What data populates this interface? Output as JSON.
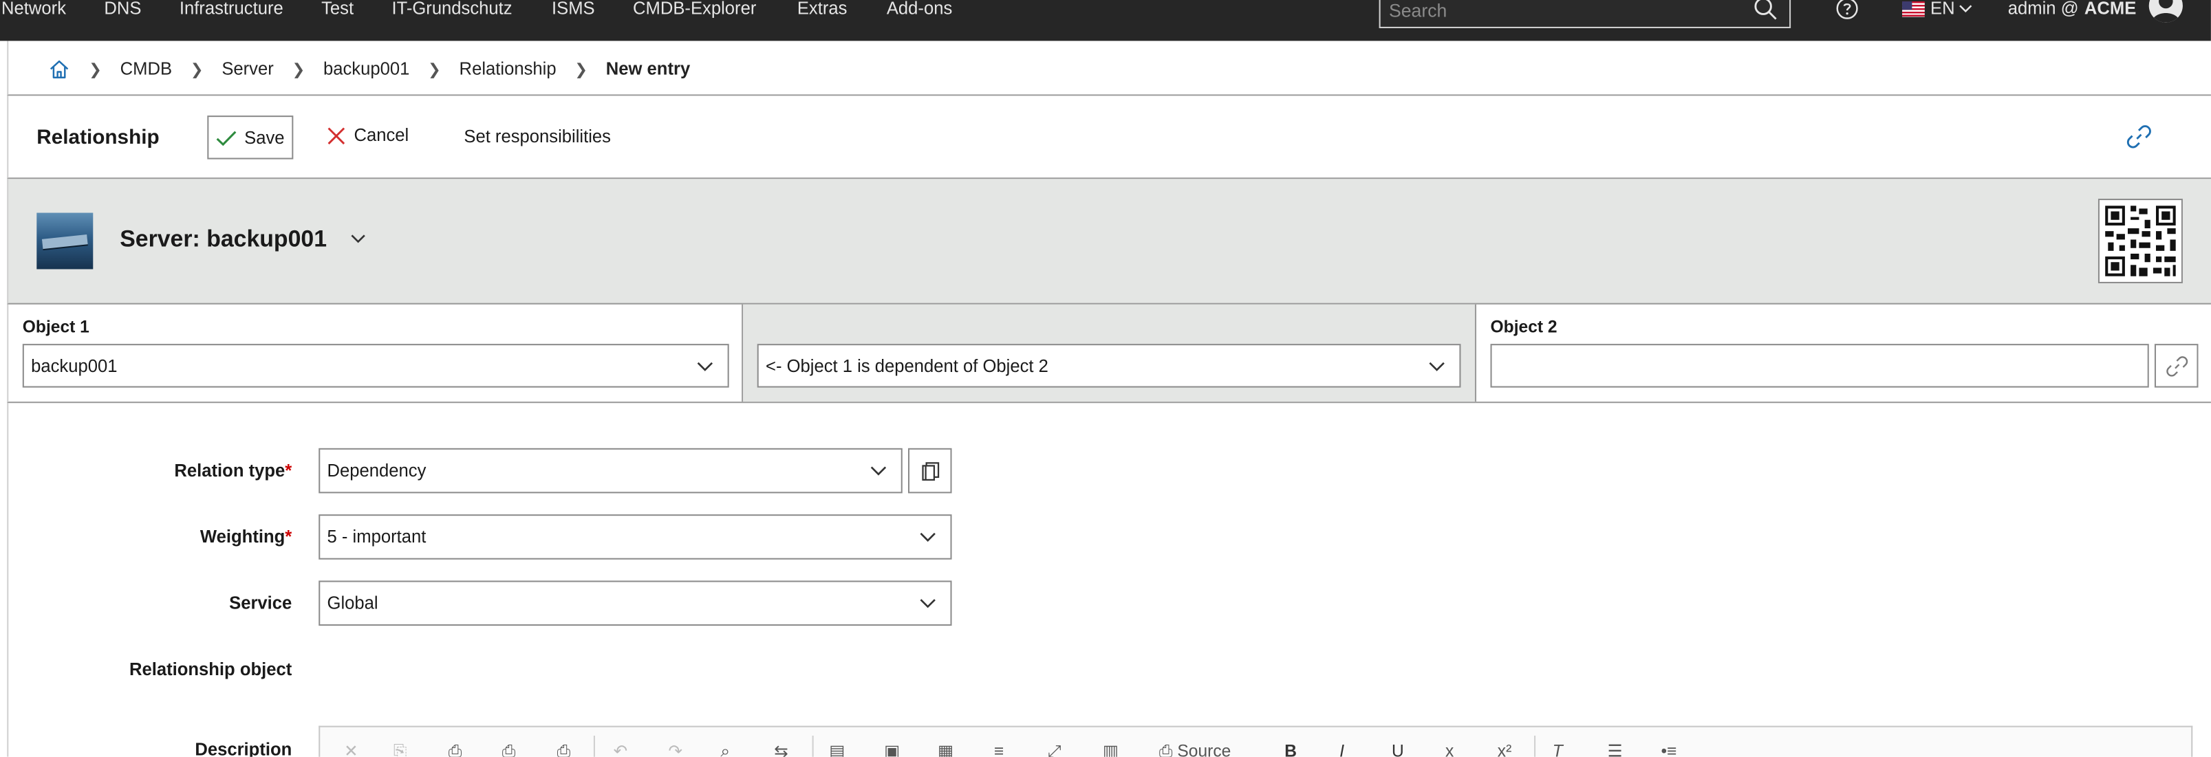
{
  "nav": {
    "menu": [
      "Network",
      "DNS",
      "Infrastructure",
      "Test",
      "IT-Grundschutz",
      "ISMS",
      "CMDB-Explorer",
      "Extras",
      "Add-ons"
    ],
    "search_placeholder": "Search",
    "language": "EN",
    "user": "admin @",
    "tenant": "ACME"
  },
  "breadcrumb": [
    "CMDB",
    "Server",
    "backup001",
    "Relationship",
    "New entry"
  ],
  "toolbar": {
    "title": "Relationship",
    "save_label": "Save",
    "cancel_label": "Cancel",
    "responsibilities_label": "Set responsibilities"
  },
  "object": {
    "title": "Server: backup001"
  },
  "relation": {
    "object1_label": "Object 1",
    "object1_value": "backup001",
    "direction_value": "<- Object 1 is dependent of Object 2",
    "object2_label": "Object 2",
    "object2_value": ""
  },
  "form": {
    "relation_type_label": "Relation type",
    "relation_type_value": "Dependency",
    "weighting_label": "Weighting",
    "weighting_value": "5 - important",
    "service_label": "Service",
    "service_value": "Global",
    "relationship_object_label": "Relationship object",
    "description_label": "Description",
    "required_marker": "*",
    "editor_source_label": "Source"
  },
  "colors": {
    "topbar": "#262626",
    "header_bg": "#e4e6e4",
    "accent_link": "#1f6fb2",
    "required": "#cc0000",
    "save_check": "#2e8b3e",
    "cancel_x": "#d32f2f"
  }
}
